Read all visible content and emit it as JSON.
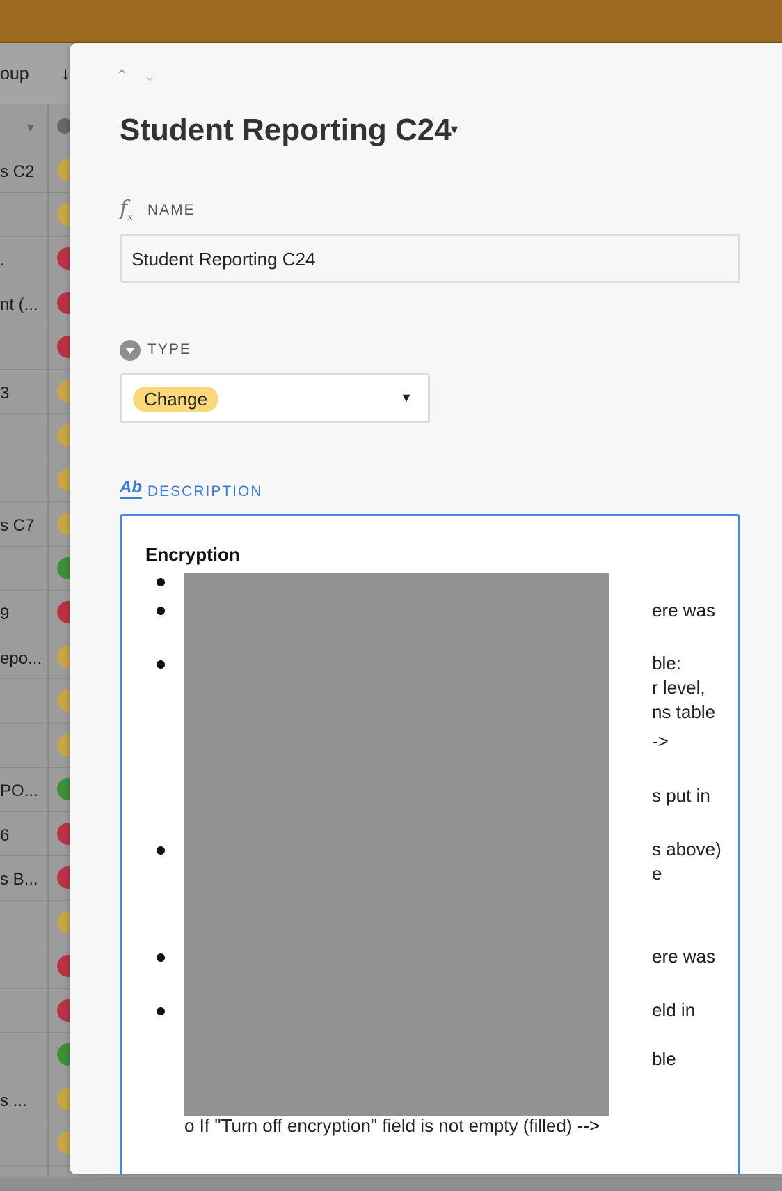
{
  "grid": {
    "toolbar_text": "oup",
    "toolbar_sort_icon": "arrow-down-icon",
    "rows": [
      {
        "text": "s C2",
        "status": "yellow"
      },
      {
        "text": "",
        "status": "yellow"
      },
      {
        "text": ".",
        "status": "red"
      },
      {
        "text": "nt (...",
        "status": "red"
      },
      {
        "text": "",
        "status": "red"
      },
      {
        "text": "3",
        "status": "yellow"
      },
      {
        "text": "",
        "status": "yellow"
      },
      {
        "text": "",
        "status": "yellow"
      },
      {
        "text": "s C7",
        "status": "yellow"
      },
      {
        "text": "",
        "status": "green"
      },
      {
        "text": "9",
        "status": "red"
      },
      {
        "text": "epo...",
        "status": "yellow"
      },
      {
        "text": "",
        "status": "yellow"
      },
      {
        "text": "",
        "status": "yellow"
      },
      {
        "text": "PO...",
        "status": "green"
      },
      {
        "text": "6",
        "status": "red"
      },
      {
        "text": "s B...",
        "status": "red"
      },
      {
        "text": "",
        "status": "yellow"
      },
      {
        "text": "",
        "status": "red"
      },
      {
        "text": "",
        "status": "red"
      },
      {
        "text": "",
        "status": "green"
      },
      {
        "text": "s ...",
        "status": "yellow"
      },
      {
        "text": "",
        "status": "yellow"
      }
    ]
  },
  "record": {
    "title": "Student Reporting C24",
    "fields": {
      "name": {
        "label": "NAME",
        "value": "Student Reporting C24"
      },
      "type": {
        "label": "TYPE",
        "value": "Change"
      },
      "description": {
        "label": "DESCRIPTION",
        "heading": "Encryption",
        "fragments": [
          "ere was",
          "ble:",
          "r level,",
          "ns table",
          "->",
          "s put in",
          "s above)",
          "e",
          "ere was",
          "eld in",
          "ble"
        ],
        "last_line": "o    If \"Turn off encryption\" field is not empty (filled) -->"
      }
    }
  },
  "colors": {
    "topbar": "#9c6b21",
    "accent": "#4a86e0",
    "chip": "#fbd97a"
  }
}
